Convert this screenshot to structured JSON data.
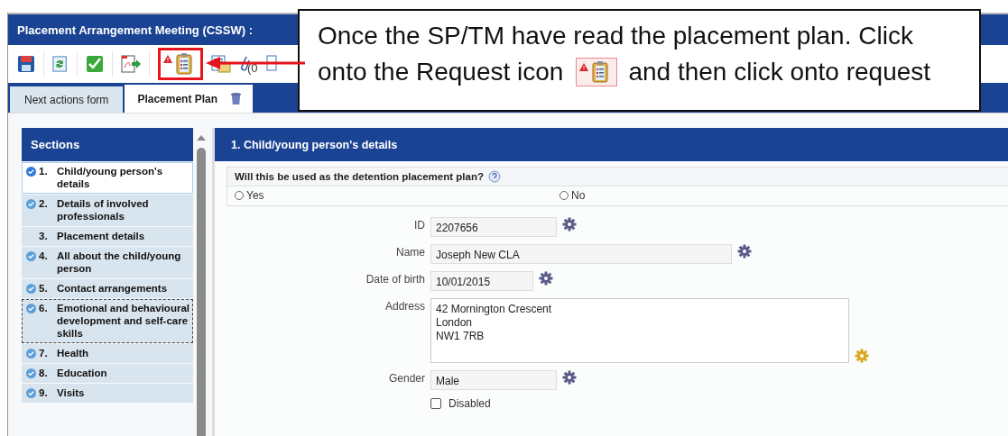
{
  "window": {
    "title": "Placement Arrangement Meeting (CSSW) :"
  },
  "toolbar": {
    "attachment_count": "(0"
  },
  "tabs": [
    {
      "label": "Next actions form",
      "selected": false
    },
    {
      "label": "Placement Plan",
      "selected": true
    }
  ],
  "sections": {
    "title": "Sections",
    "items": [
      {
        "number": "1.",
        "label": "Child/young person's details",
        "complete": true,
        "selected": true,
        "focused": false
      },
      {
        "number": "2.",
        "label": "Details of involved professionals",
        "complete": true,
        "selected": false,
        "focused": false
      },
      {
        "number": "3.",
        "label": "Placement details",
        "complete": false,
        "selected": false,
        "focused": false
      },
      {
        "number": "4.",
        "label": "All about the child/young person",
        "complete": true,
        "selected": false,
        "focused": false
      },
      {
        "number": "5.",
        "label": "Contact arrangements",
        "complete": true,
        "selected": false,
        "focused": false
      },
      {
        "number": "6.",
        "label": "Emotional and behavioural development and self-care skills",
        "complete": true,
        "selected": false,
        "focused": true
      },
      {
        "number": "7.",
        "label": "Health",
        "complete": true,
        "selected": false,
        "focused": false
      },
      {
        "number": "8.",
        "label": "Education",
        "complete": true,
        "selected": false,
        "focused": false
      },
      {
        "number": "9.",
        "label": "Visits",
        "complete": true,
        "selected": false,
        "focused": false
      }
    ]
  },
  "panel": {
    "title": "1. Child/young person's details",
    "question": {
      "text": "Will this be used as the detention placement plan?",
      "options": [
        {
          "label": "Yes",
          "selected": false
        },
        {
          "label": "No",
          "selected": false
        }
      ]
    },
    "fields": [
      {
        "kind": "input",
        "label": "ID",
        "value": "2207656",
        "gear_highlighted": false
      },
      {
        "kind": "input",
        "label": "Name",
        "value": "Joseph New CLA",
        "gear_highlighted": false
      },
      {
        "kind": "input",
        "label": "Date of birth",
        "value": "10/01/2015",
        "gear_highlighted": false
      },
      {
        "kind": "textarea",
        "label": "Address",
        "value": "42 Mornington Crescent\nLondon\nNW1 7RB",
        "gear_highlighted": true
      },
      {
        "kind": "input",
        "label": "Gender",
        "value": "Male",
        "gear_highlighted": false
      }
    ],
    "checkbox": {
      "label": "Disabled",
      "checked": false
    }
  },
  "callout": {
    "line_1": "Once the SP/TM have read the placement plan. Click",
    "line_2_before_icon": "onto the Request icon",
    "line_2_after_icon": "and then click onto request"
  }
}
